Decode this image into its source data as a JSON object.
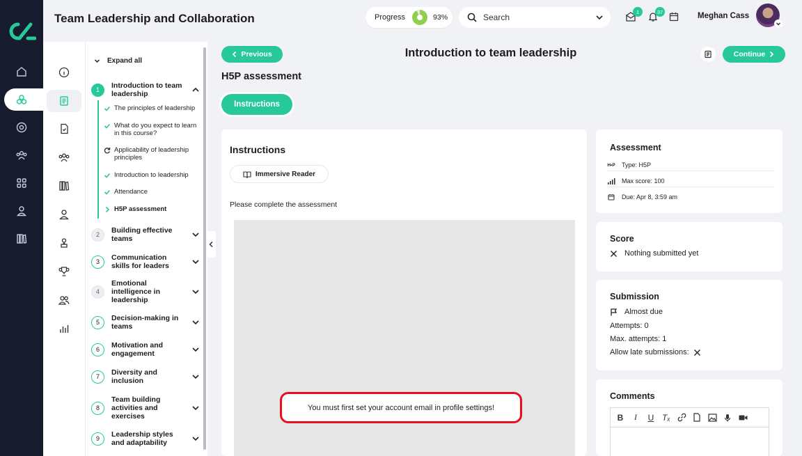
{
  "course": {
    "title": "Team Leadership and Collaboration"
  },
  "header": {
    "progress_label": "Progress",
    "progress_value": "93%",
    "progress_fraction": 0.93,
    "search_placeholder": "Search",
    "messages_badge": "1",
    "notifications_badge": "37",
    "user_name": "Meghan Cass"
  },
  "rail": {
    "icons": [
      "home-icon",
      "learning-icon",
      "compass-icon",
      "people-icon",
      "apps-icon",
      "user-icon",
      "library-icon"
    ]
  },
  "secondary_nav": {
    "icons": [
      "info-icon",
      "lessons-icon",
      "document-icon",
      "team-icon",
      "books-icon",
      "profile-icon",
      "award-user-icon",
      "trophy-icon",
      "group-icon",
      "stats-icon"
    ]
  },
  "outline": {
    "expand_all": "Expand all",
    "modules": [
      {
        "num": "1",
        "title": "Introduction to team leadership"
      },
      {
        "num": "2",
        "title": "Building effective teams"
      },
      {
        "num": "3",
        "title": "Communication skills for leaders"
      },
      {
        "num": "4",
        "title": "Emotional intelligence in leadership"
      },
      {
        "num": "5",
        "title": "Decision-making in teams"
      },
      {
        "num": "6",
        "title": "Motivation and engagement"
      },
      {
        "num": "7",
        "title": "Diversity and inclusion"
      },
      {
        "num": "8",
        "title": "Team building activities and exercises"
      },
      {
        "num": "9",
        "title": "Leadership styles and adaptability"
      }
    ],
    "lessons": [
      {
        "title": "The principles of leadership",
        "status": "done"
      },
      {
        "title": "What do you expect to learn in this course?",
        "status": "done"
      },
      {
        "title": "Applicability of leadership principles",
        "status": "in-progress"
      },
      {
        "title": "Introduction to leadership",
        "status": "done"
      },
      {
        "title": "Attendance",
        "status": "done"
      },
      {
        "title": "H5P assessment",
        "status": "current"
      }
    ]
  },
  "main": {
    "prev_label": "Previous",
    "next_label": "Continue",
    "page_title": "Introduction to team leadership",
    "section_title": "H5P assessment",
    "tab_label": "Instructions",
    "instructions_title": "Instructions",
    "reader_label": "Immersive Reader",
    "instruction_text": "Please complete the assessment",
    "alert_text": "You must first set your account email in profile settings!"
  },
  "assessment": {
    "title": "Assessment",
    "type_icon": "H•P",
    "type": "Type: H5P",
    "max_score": "Max score: 100",
    "due": "Due: Apr 8, 3:59 am"
  },
  "score": {
    "title": "Score",
    "status": "Nothing submitted yet"
  },
  "submission": {
    "title": "Submission",
    "status": "Almost due",
    "attempts": "Attempts: 0",
    "max_attempts": "Max. attempts: 1",
    "allow_late": "Allow late submissions:"
  },
  "comments": {
    "title": "Comments"
  },
  "colors": {
    "accent": "#27c99b",
    "rail": "#161b2e",
    "alert": "#e8101e",
    "progress": "#8fd14f"
  }
}
